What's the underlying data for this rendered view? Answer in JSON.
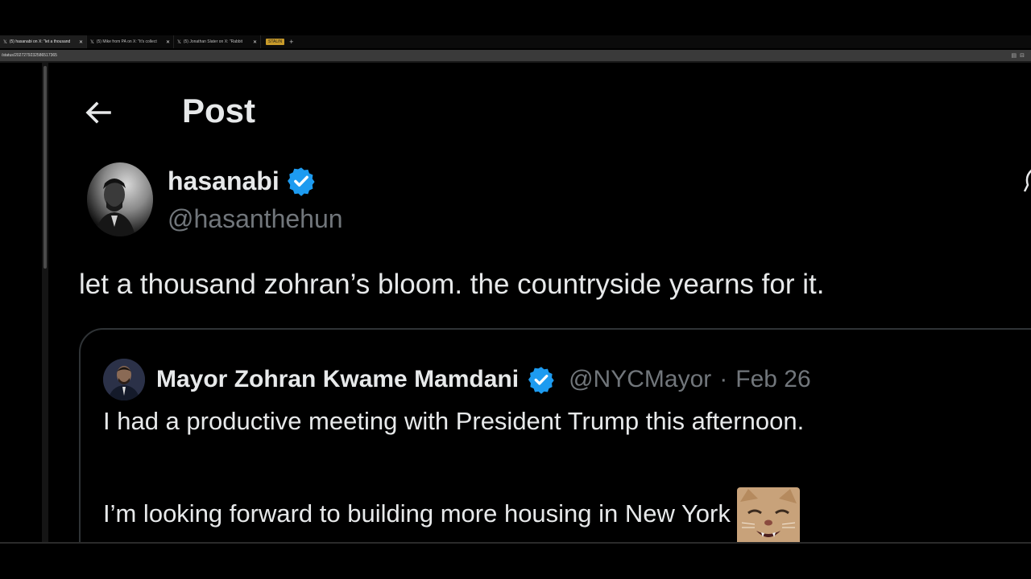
{
  "browser": {
    "tabs": [
      {
        "icon": "x-logo-icon",
        "title": "(5) hasanabi on X: \"let a thousand",
        "active": true
      },
      {
        "icon": "x-logo-icon",
        "title": "(5) Mike from PA on X: \"It's collect",
        "active": false
      },
      {
        "icon": "x-logo-icon",
        "title": "(5) Jonathan Slater on X: \"Rabbit",
        "active": false
      }
    ],
    "tab_badge": "STALIN",
    "new_tab_symbol": "+",
    "url": "/status/2027279232586517365"
  },
  "page": {
    "back_icon": "arrow-left-icon",
    "heading": "Post"
  },
  "post": {
    "author_name": "hasanabi",
    "author_handle": "@hasanthehun",
    "verified_icon": "verified-badge-icon",
    "text": "let a thousand zohran’s bloom. the countryside yearns for it.",
    "quote": {
      "author_name": "Mayor Zohran Kwame Mamdani",
      "author_handle": "@NYCMayor",
      "separator": "·",
      "date": "Feb 26",
      "line1": "I had a productive meeting with President Trump this afternoon.",
      "line2": "I’m looking forward to building more housing in New York",
      "emoji": "cat-emoji-icon"
    }
  },
  "colors": {
    "background": "#000000",
    "text_primary": "#e7e9ea",
    "text_secondary": "#71767b",
    "verified_blue": "#1d9bf0",
    "border": "#2f3336"
  }
}
